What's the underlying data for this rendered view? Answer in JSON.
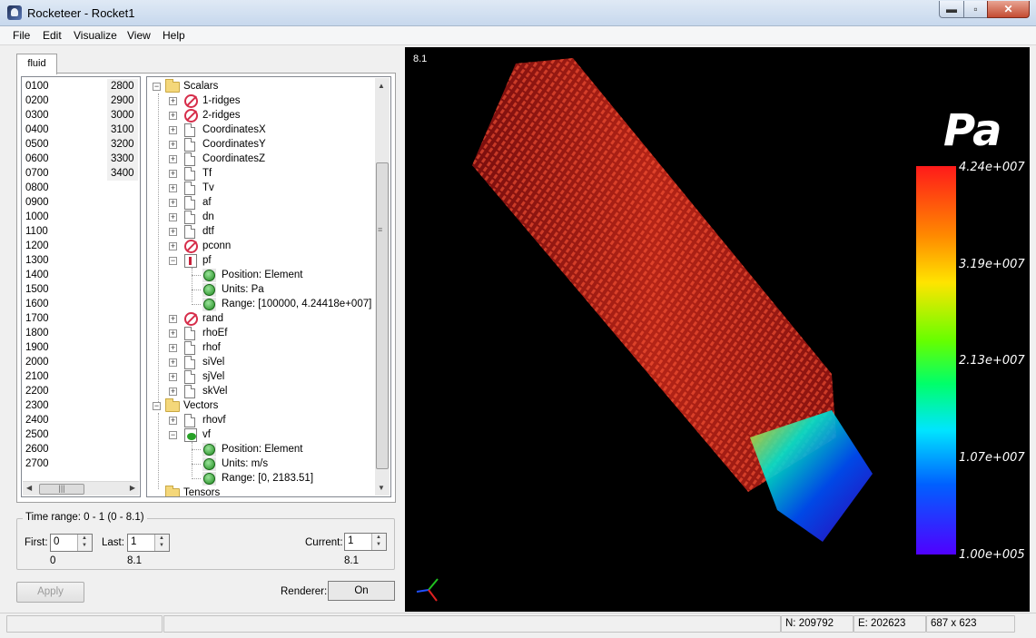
{
  "window": {
    "title": "Rocketeer - Rocket1",
    "minimize_glyph": "▬",
    "maximize_glyph": "▫",
    "close_glyph": "✕"
  },
  "menu": [
    "File",
    "Edit",
    "Visualize",
    "View",
    "Help"
  ],
  "tab": {
    "label": "fluid"
  },
  "timesteps": {
    "col1": [
      "0100",
      "0200",
      "0300",
      "0400",
      "0500",
      "0600",
      "0700",
      "0800",
      "0900",
      "1000",
      "1100",
      "1200",
      "1300",
      "1400",
      "1500",
      "1600",
      "1700",
      "1800",
      "1900",
      "2000",
      "2100",
      "2200",
      "2300",
      "2400",
      "2500",
      "2600",
      "2700"
    ],
    "col2": [
      "2800",
      "2900",
      "3000",
      "3100",
      "3200",
      "3300",
      "3400"
    ]
  },
  "tree": [
    {
      "label": "Scalars",
      "icon": "folder-icon",
      "level": 0,
      "expander": "minus"
    },
    {
      "label": "1-ridges",
      "icon": "no-icon",
      "level": 1,
      "expander": "plus"
    },
    {
      "label": "2-ridges",
      "icon": "no-icon",
      "level": 1,
      "expander": "plus"
    },
    {
      "label": "CoordinatesX",
      "icon": "doc-icon",
      "level": 1,
      "expander": "plus"
    },
    {
      "label": "CoordinatesY",
      "icon": "doc-icon",
      "level": 1,
      "expander": "plus"
    },
    {
      "label": "CoordinatesZ",
      "icon": "doc-icon",
      "level": 1,
      "expander": "plus"
    },
    {
      "label": "Tf",
      "icon": "doc-icon",
      "level": 1,
      "expander": "plus"
    },
    {
      "label": "Tv",
      "icon": "doc-icon",
      "level": 1,
      "expander": "plus"
    },
    {
      "label": "af",
      "icon": "doc-icon",
      "level": 1,
      "expander": "plus"
    },
    {
      "label": "dn",
      "icon": "doc-icon",
      "level": 1,
      "expander": "plus"
    },
    {
      "label": "dtf",
      "icon": "doc-icon",
      "level": 1,
      "expander": "plus"
    },
    {
      "label": "pconn",
      "icon": "no-icon",
      "level": 1,
      "expander": "plus"
    },
    {
      "label": "pf",
      "icon": "pf-icon",
      "level": 1,
      "expander": "minus"
    },
    {
      "label": "Position: Element",
      "icon": "prop-icon",
      "level": 2,
      "expander": "none"
    },
    {
      "label": "Units: Pa",
      "icon": "prop-icon",
      "level": 2,
      "expander": "none"
    },
    {
      "label": "Range: [100000, 4.24418e+007]",
      "icon": "prop-icon",
      "level": 2,
      "expander": "none"
    },
    {
      "label": "rand",
      "icon": "no-icon",
      "level": 1,
      "expander": "plus"
    },
    {
      "label": "rhoEf",
      "icon": "doc-icon",
      "level": 1,
      "expander": "plus"
    },
    {
      "label": "rhof",
      "icon": "doc-icon",
      "level": 1,
      "expander": "plus"
    },
    {
      "label": "siVel",
      "icon": "doc-icon",
      "level": 1,
      "expander": "plus"
    },
    {
      "label": "sjVel",
      "icon": "doc-icon",
      "level": 1,
      "expander": "plus"
    },
    {
      "label": "skVel",
      "icon": "doc-icon",
      "level": 1,
      "expander": "plus"
    },
    {
      "label": "Vectors",
      "icon": "folder-icon",
      "level": 0,
      "expander": "minus"
    },
    {
      "label": "rhovf",
      "icon": "doc-icon",
      "level": 1,
      "expander": "plus"
    },
    {
      "label": "vf",
      "icon": "vf-icon",
      "level": 1,
      "expander": "minus"
    },
    {
      "label": "Position: Element",
      "icon": "prop-icon",
      "level": 2,
      "expander": "none"
    },
    {
      "label": "Units: m/s",
      "icon": "prop-icon",
      "level": 2,
      "expander": "none"
    },
    {
      "label": "Range: [0, 2183.51]",
      "icon": "prop-icon",
      "level": 2,
      "expander": "none"
    },
    {
      "label": "Tensors",
      "icon": "folder-icon",
      "level": 0,
      "expander": "none"
    }
  ],
  "time_range": {
    "title": "Time range: 0 - 1 (0 - 8.1)",
    "first_label": "First:",
    "first_value": "0",
    "first_caption": "0",
    "last_label": "Last:",
    "last_value": "1",
    "last_caption": "8.1",
    "current_label": "Current:",
    "current_value": "1",
    "current_caption": "8.1"
  },
  "apply_label": "Apply",
  "renderer": {
    "label": "Renderer:",
    "value": "On"
  },
  "viewport": {
    "time_label": "8.1",
    "colorbar": {
      "unit": "Pa",
      "ticks": [
        "4.24e+007",
        "3.19e+007",
        "2.13e+007",
        "1.07e+007",
        "1.00e+005"
      ]
    }
  },
  "status": {
    "n": "N: 209792",
    "e": "E: 202623",
    "size": "687 x 623"
  },
  "colors": {
    "background": "#000000",
    "accent_high": "#ff1a1a",
    "accent_low": "#5000ff"
  }
}
